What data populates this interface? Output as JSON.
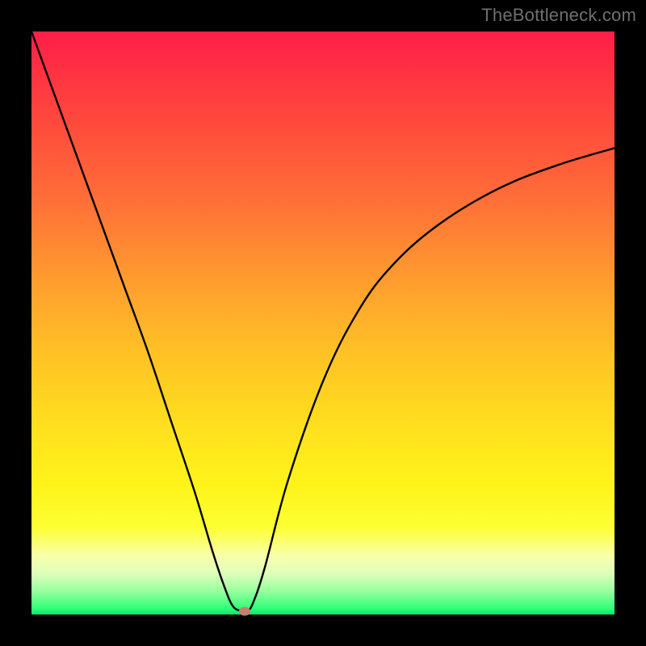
{
  "watermark": "TheBottleneck.com",
  "colors": {
    "frame": "#000000",
    "curve": "#000000",
    "marker": "#c87f6b"
  },
  "chart_data": {
    "type": "line",
    "title": "",
    "xlabel": "",
    "ylabel": "",
    "xlim": [
      0,
      100
    ],
    "ylim": [
      0,
      100
    ],
    "grid": false,
    "notes": "Bottleneck-style curve with V-shaped minimum near x≈36; y is bottleneck percentage (0 = balanced, high = bottlenecked).",
    "series": [
      {
        "name": "bottleneck_curve",
        "x": [
          0,
          4,
          8,
          12,
          16,
          20,
          24,
          28,
          31,
          33,
          34.5,
          36,
          37,
          38,
          40,
          44,
          50,
          56,
          62,
          70,
          80,
          90,
          100
        ],
        "y": [
          100,
          89,
          78,
          67,
          56,
          45,
          33,
          21,
          11,
          5,
          1.5,
          0.6,
          0.6,
          2,
          8,
          23,
          40,
          52,
          60,
          67,
          73,
          77,
          80
        ]
      }
    ],
    "marker": {
      "x": 36.5,
      "y": 0.6
    }
  }
}
